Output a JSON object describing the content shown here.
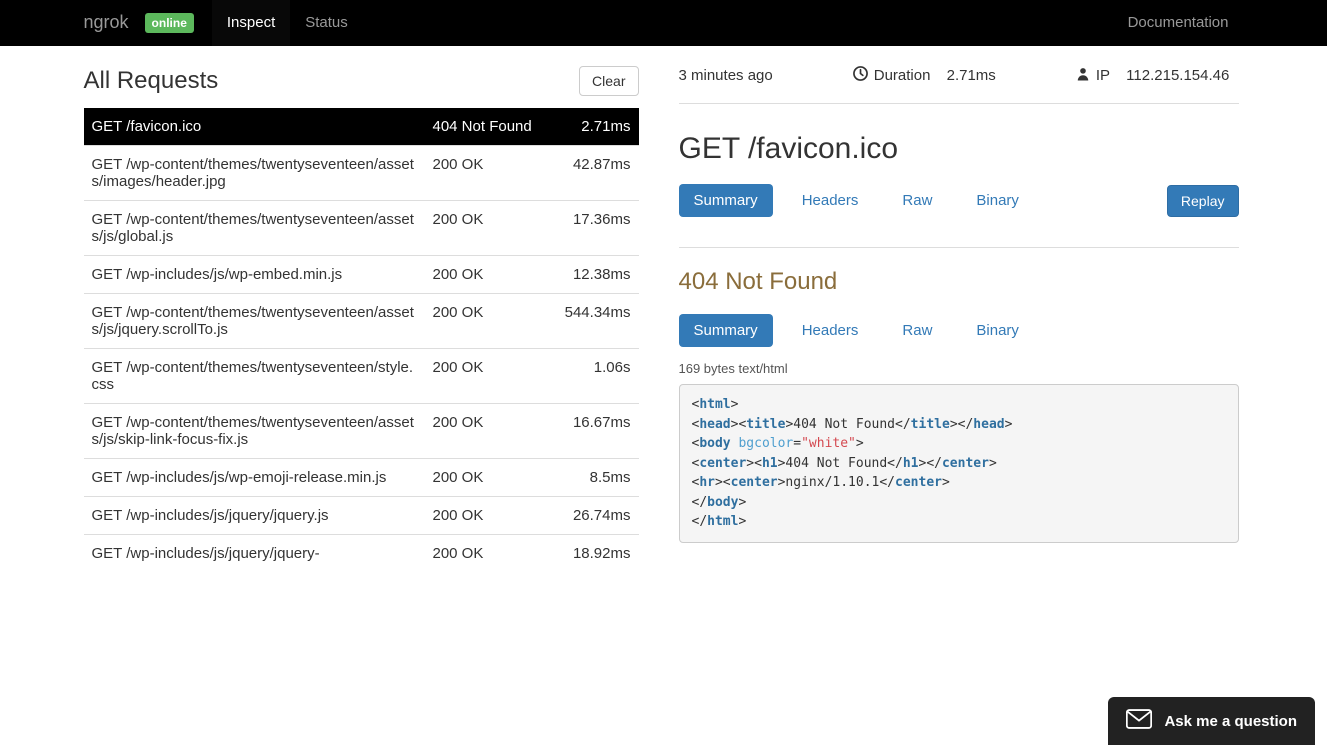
{
  "nav": {
    "brand": "ngrok",
    "badge": "online",
    "items": [
      "Inspect",
      "Status"
    ],
    "active": 0,
    "right": "Documentation"
  },
  "requests_header": {
    "title": "All Requests",
    "clear": "Clear"
  },
  "requests": [
    {
      "method": "GET",
      "path": "/favicon.ico",
      "status": "404 Not Found",
      "time": "2.71ms",
      "selected": true
    },
    {
      "method": "GET",
      "path": "/wp-content/themes/twentyseventeen/assets/images/header.jpg",
      "status": "200 OK",
      "time": "42.87ms"
    },
    {
      "method": "GET",
      "path": "/wp-content/themes/twentyseventeen/assets/js/global.js",
      "status": "200 OK",
      "time": "17.36ms"
    },
    {
      "method": "GET",
      "path": "/wp-includes/js/wp-embed.min.js",
      "status": "200 OK",
      "time": "12.38ms"
    },
    {
      "method": "GET",
      "path": "/wp-content/themes/twentyseventeen/assets/js/jquery.scrollTo.js",
      "status": "200 OK",
      "time": "544.34ms"
    },
    {
      "method": "GET",
      "path": "/wp-content/themes/twentyseventeen/style.css",
      "status": "200 OK",
      "time": "1.06s"
    },
    {
      "method": "GET",
      "path": "/wp-content/themes/twentyseventeen/assets/js/skip-link-focus-fix.js",
      "status": "200 OK",
      "time": "16.67ms"
    },
    {
      "method": "GET",
      "path": "/wp-includes/js/wp-emoji-release.min.js",
      "status": "200 OK",
      "time": "8.5ms"
    },
    {
      "method": "GET",
      "path": "/wp-includes/js/jquery/jquery.js",
      "status": "200 OK",
      "time": "26.74ms"
    },
    {
      "method": "GET",
      "path": "/wp-includes/js/jquery/jquery-",
      "status": "200 OK",
      "time": "18.92ms"
    }
  ],
  "detail": {
    "time_ago": "3 minutes ago",
    "duration_label": "Duration",
    "duration_value": "2.71ms",
    "ip_label": "IP",
    "ip_value": "112.215.154.46",
    "request_title": "GET /favicon.ico",
    "tabs": [
      "Summary",
      "Headers",
      "Raw",
      "Binary"
    ],
    "active_tab": 0,
    "replay": "Replay",
    "response_status": "404 Not Found",
    "bytes_info": "169 bytes text/html"
  },
  "ask": "Ask me a question"
}
